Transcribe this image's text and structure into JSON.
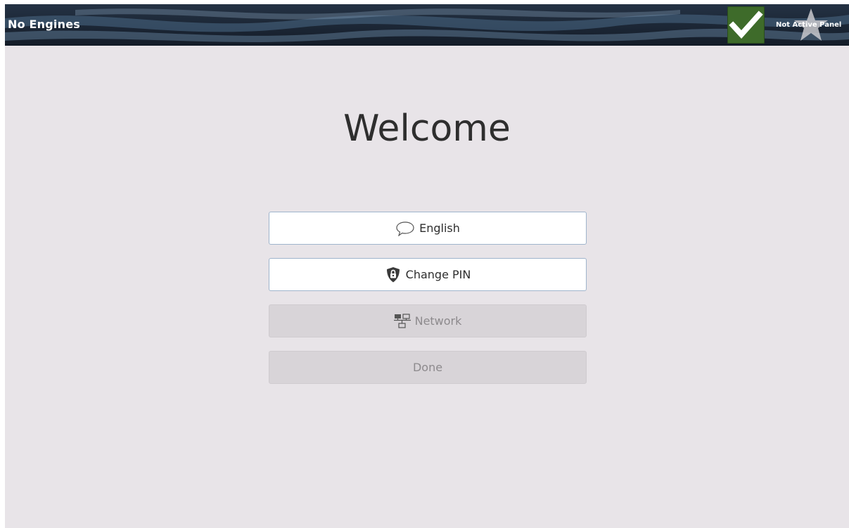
{
  "header": {
    "engine_status": "No Engines",
    "panel_status": "Not Active Panel",
    "check_icon": "checkmark-icon",
    "star_icon": "star-icon",
    "accent_check_color": "#3e6b2a"
  },
  "main": {
    "title": "Welcome",
    "buttons": [
      {
        "label": "English",
        "icon": "speech-bubble-icon",
        "enabled": true
      },
      {
        "label": "Change PIN",
        "icon": "shield-lock-icon",
        "enabled": true
      },
      {
        "label": "Network",
        "icon": "network-icon",
        "enabled": false
      },
      {
        "label": "Done",
        "icon": "",
        "enabled": false
      }
    ]
  }
}
